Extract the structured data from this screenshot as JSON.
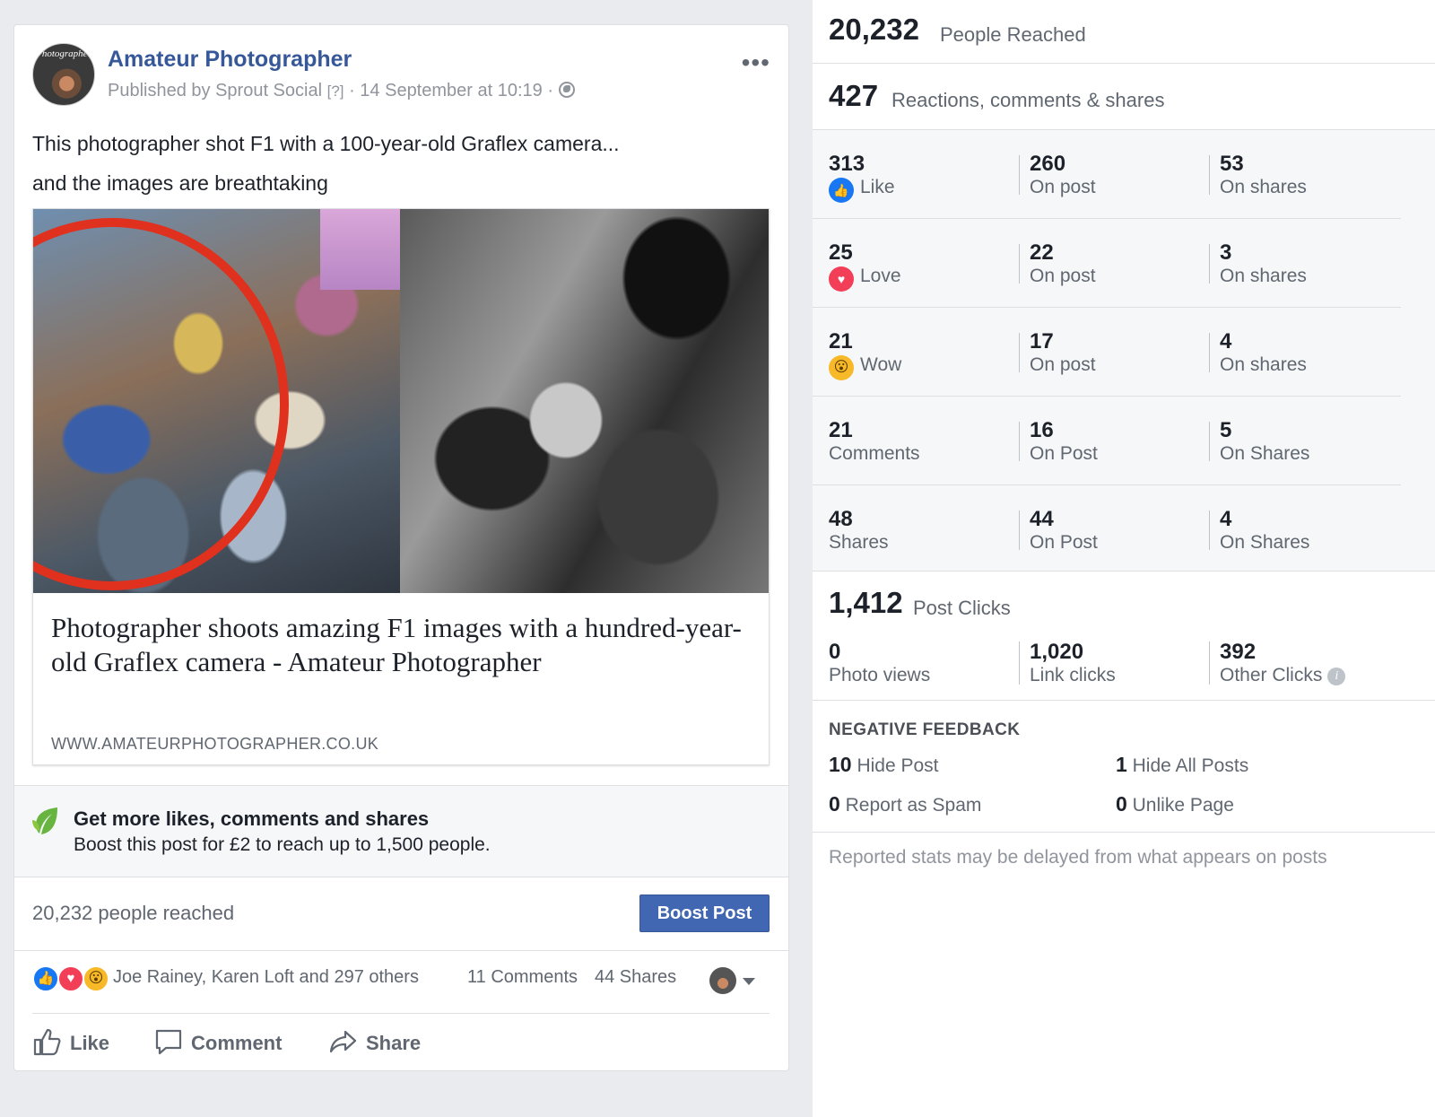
{
  "post": {
    "page_name": "Amateur Photographer",
    "avatar_text": "Photographer",
    "published_by": "Published by Sprout Social",
    "help_mark": "[?]",
    "date": "14 September at 10:19",
    "more_icon": "ellipsis-icon",
    "text_line1": "This photographer shot F1 with a 100-year-old Graflex camera...",
    "text_line2": "and the images are breathtaking",
    "link": {
      "title": "Photographer shoots amazing F1 images with a hundred-year-old Graflex camera - Amateur Photographer",
      "domain": "WWW.AMATEURPHOTOGRAPHER.CO.UK"
    },
    "boost_promo": {
      "title": "Get more likes, comments and shares",
      "subtitle": "Boost this post for £2 to reach up to 1,500 people."
    },
    "reach_text": "20,232 people reached",
    "boost_button": "Boost Post",
    "reactors": "Joe Rainey, Karen Loft and 297 others",
    "comments": "11 Comments",
    "shares": "44 Shares",
    "actions": {
      "like": "Like",
      "comment": "Comment",
      "share": "Share"
    }
  },
  "stats": {
    "reached": {
      "value": "20,232",
      "label": "People Reached"
    },
    "engagement": {
      "value": "427",
      "label": "Reactions, comments & shares"
    },
    "rows": [
      {
        "total": "313",
        "label": "Like",
        "icon": "like-reaction-icon",
        "on_post": "260",
        "on_post_label": "On post",
        "on_shares": "53",
        "on_shares_label": "On shares"
      },
      {
        "total": "25",
        "label": "Love",
        "icon": "love-reaction-icon",
        "on_post": "22",
        "on_post_label": "On post",
        "on_shares": "3",
        "on_shares_label": "On shares"
      },
      {
        "total": "21",
        "label": "Wow",
        "icon": "wow-reaction-icon",
        "on_post": "17",
        "on_post_label": "On post",
        "on_shares": "4",
        "on_shares_label": "On shares"
      },
      {
        "total": "21",
        "label": "Comments",
        "on_post": "16",
        "on_post_label": "On Post",
        "on_shares": "5",
        "on_shares_label": "On Shares"
      },
      {
        "total": "48",
        "label": "Shares",
        "on_post": "44",
        "on_post_label": "On Post",
        "on_shares": "4",
        "on_shares_label": "On Shares"
      }
    ],
    "clicks": {
      "value": "1,412",
      "label": "Post Clicks",
      "photo_views": "0",
      "photo_views_label": "Photo views",
      "link_clicks": "1,020",
      "link_clicks_label": "Link clicks",
      "other_clicks": "392",
      "other_clicks_label": "Other Clicks"
    },
    "negative": {
      "title": "NEGATIVE FEEDBACK",
      "hide_post": "10",
      "hide_post_label": "Hide Post",
      "hide_all": "1",
      "hide_all_label": "Hide All Posts",
      "spam": "0",
      "spam_label": "Report as Spam",
      "unlike": "0",
      "unlike_label": "Unlike Page"
    },
    "footnote": "Reported stats may be delayed from what appears on posts"
  },
  "colors": {
    "brand_blue": "#4267b2",
    "link_blue": "#365899",
    "circle_red": "#e0301e"
  }
}
